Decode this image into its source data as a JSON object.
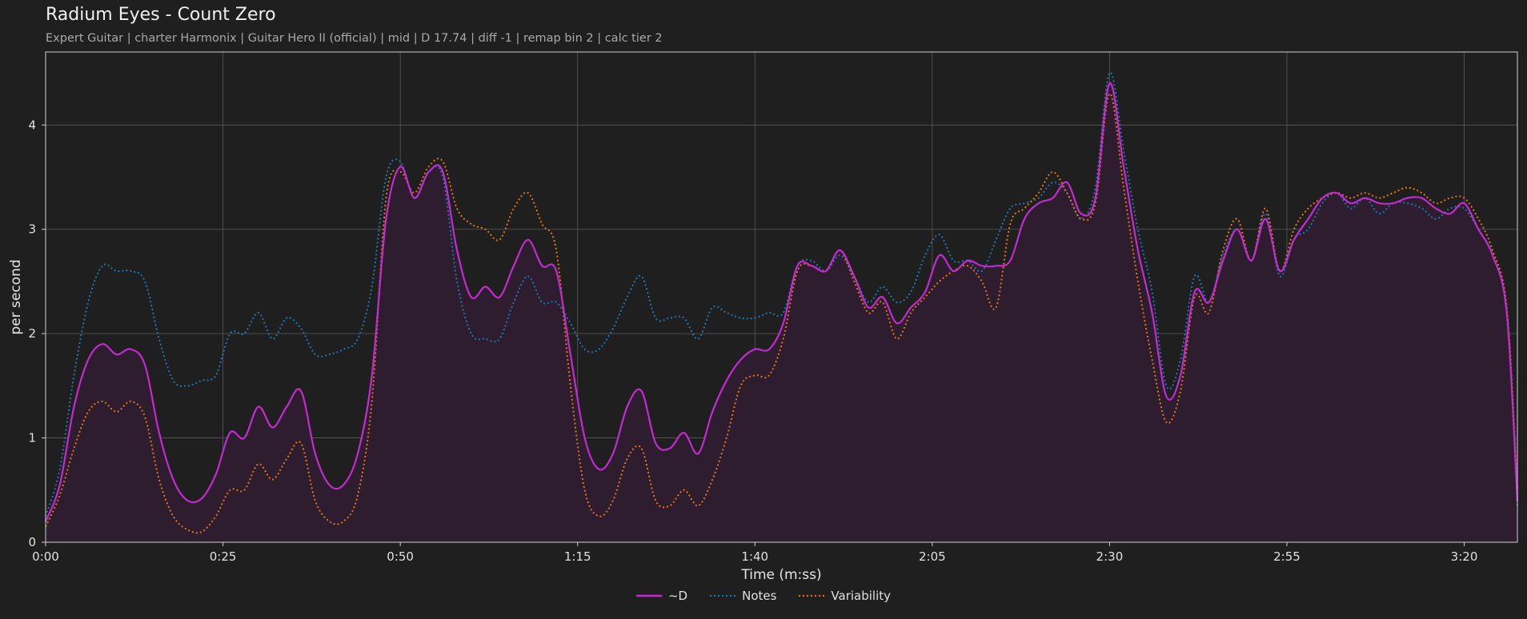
{
  "header": {
    "title": "Radium Eyes - Count Zero",
    "subtitle": "Expert Guitar  |  charter Harmonix  |  Guitar Hero II (official)  |  mid  |  D 17.74  |  diff -1  |  remap bin 2  |  calc tier 2"
  },
  "colors": {
    "background": "#1f1f1f",
    "d": "#c42ad0",
    "notes": "#1f77b4",
    "variability": "#e2761a",
    "fill": "#2e1c2f",
    "grid": "#5a5a5a"
  },
  "chart_data": {
    "type": "line",
    "xlabel": "Time (m:ss)",
    "ylabel": "per second",
    "xlim": [
      0,
      207.5
    ],
    "ylim": [
      0,
      4.7
    ],
    "x_ticks": [
      0,
      25,
      50,
      75,
      100,
      125,
      150,
      175,
      200
    ],
    "x_tick_labels": [
      "0:00",
      "0:25",
      "0:50",
      "1:15",
      "1:40",
      "2:05",
      "2:30",
      "2:55",
      "3:20"
    ],
    "y_ticks": [
      0,
      1,
      2,
      3,
      4
    ],
    "y_tick_labels": [
      "0",
      "1",
      "2",
      "3",
      "4"
    ],
    "grid": true,
    "legend_position": "bottom-center",
    "x": [
      0,
      2,
      4,
      6,
      8,
      10,
      12,
      14,
      16,
      18,
      20,
      22,
      24,
      26,
      28,
      30,
      32,
      34,
      36,
      38,
      40,
      42,
      44,
      46,
      48,
      50,
      52,
      54,
      56,
      58,
      60,
      62,
      64,
      66,
      68,
      70,
      72,
      74,
      76,
      78,
      80,
      82,
      84,
      86,
      88,
      90,
      92,
      94,
      96,
      98,
      100,
      102,
      104,
      106,
      108,
      110,
      112,
      114,
      116,
      118,
      120,
      122,
      124,
      126,
      128,
      130,
      132,
      134,
      136,
      138,
      140,
      142,
      144,
      146,
      148,
      150,
      152,
      154,
      156,
      158,
      160,
      162,
      164,
      166,
      168,
      170,
      172,
      174,
      176,
      178,
      180,
      182,
      184,
      186,
      188,
      190,
      192,
      194,
      196,
      198,
      200,
      202,
      204,
      206,
      207.5
    ],
    "series": [
      {
        "name": "~D",
        "style": "solid",
        "values": [
          0.2,
          0.55,
          1.3,
          1.75,
          1.9,
          1.8,
          1.85,
          1.7,
          1.05,
          0.6,
          0.4,
          0.42,
          0.65,
          1.05,
          1.0,
          1.3,
          1.1,
          1.3,
          1.45,
          0.85,
          0.55,
          0.55,
          0.85,
          1.6,
          3.1,
          3.6,
          3.3,
          3.55,
          3.55,
          2.8,
          2.35,
          2.45,
          2.35,
          2.65,
          2.9,
          2.65,
          2.6,
          1.8,
          1.0,
          0.7,
          0.85,
          1.3,
          1.45,
          0.95,
          0.9,
          1.05,
          0.85,
          1.25,
          1.55,
          1.75,
          1.85,
          1.85,
          2.1,
          2.65,
          2.65,
          2.6,
          2.8,
          2.55,
          2.25,
          2.35,
          2.1,
          2.25,
          2.4,
          2.75,
          2.6,
          2.7,
          2.65,
          2.65,
          2.7,
          3.1,
          3.25,
          3.3,
          3.45,
          3.15,
          3.3,
          4.4,
          3.6,
          2.8,
          2.2,
          1.4,
          1.6,
          2.4,
          2.3,
          2.7,
          3.0,
          2.7,
          3.1,
          2.6,
          2.9,
          3.1,
          3.3,
          3.35,
          3.25,
          3.3,
          3.25,
          3.25,
          3.3,
          3.3,
          3.2,
          3.15,
          3.25,
          3.0,
          2.75,
          2.2,
          0.4
        ]
      },
      {
        "name": "Notes",
        "style": "dotted",
        "values": [
          0.25,
          0.7,
          1.6,
          2.3,
          2.65,
          2.6,
          2.6,
          2.5,
          1.95,
          1.55,
          1.5,
          1.55,
          1.6,
          2.0,
          2.0,
          2.2,
          1.95,
          2.15,
          2.05,
          1.8,
          1.8,
          1.85,
          1.95,
          2.45,
          3.5,
          3.65,
          3.3,
          3.55,
          3.5,
          2.5,
          2.0,
          1.95,
          1.95,
          2.3,
          2.55,
          2.3,
          2.3,
          2.1,
          1.85,
          1.85,
          2.05,
          2.35,
          2.55,
          2.15,
          2.15,
          2.15,
          1.95,
          2.25,
          2.2,
          2.15,
          2.15,
          2.2,
          2.2,
          2.65,
          2.7,
          2.6,
          2.75,
          2.55,
          2.3,
          2.45,
          2.3,
          2.4,
          2.75,
          2.95,
          2.7,
          2.7,
          2.6,
          2.9,
          3.2,
          3.25,
          3.3,
          3.45,
          3.35,
          3.1,
          3.4,
          4.5,
          3.75,
          3.0,
          2.4,
          1.5,
          1.75,
          2.55,
          2.3,
          2.75,
          3.0,
          2.7,
          3.15,
          2.55,
          2.9,
          3.0,
          3.25,
          3.35,
          3.2,
          3.3,
          3.15,
          3.25,
          3.25,
          3.2,
          3.1,
          3.2,
          3.2,
          3.0,
          2.75,
          2.2,
          0.35
        ]
      },
      {
        "name": "Variability",
        "style": "dotted",
        "values": [
          0.15,
          0.45,
          0.9,
          1.25,
          1.35,
          1.25,
          1.35,
          1.2,
          0.6,
          0.25,
          0.12,
          0.1,
          0.25,
          0.5,
          0.5,
          0.75,
          0.6,
          0.8,
          0.95,
          0.4,
          0.2,
          0.2,
          0.45,
          1.35,
          3.3,
          3.55,
          3.35,
          3.6,
          3.65,
          3.2,
          3.05,
          3.0,
          2.9,
          3.2,
          3.35,
          3.05,
          2.8,
          1.5,
          0.5,
          0.25,
          0.4,
          0.8,
          0.9,
          0.4,
          0.35,
          0.5,
          0.35,
          0.6,
          1.0,
          1.5,
          1.6,
          1.6,
          1.95,
          2.6,
          2.65,
          2.6,
          2.8,
          2.5,
          2.2,
          2.3,
          1.95,
          2.2,
          2.35,
          2.5,
          2.6,
          2.65,
          2.5,
          2.25,
          3.05,
          3.2,
          3.35,
          3.55,
          3.35,
          3.1,
          3.25,
          4.3,
          3.4,
          2.5,
          1.75,
          1.15,
          1.45,
          2.35,
          2.2,
          2.8,
          3.1,
          2.7,
          3.2,
          2.6,
          3.0,
          3.2,
          3.3,
          3.35,
          3.3,
          3.35,
          3.3,
          3.35,
          3.4,
          3.35,
          3.25,
          3.3,
          3.3,
          3.1,
          2.8,
          2.25,
          0.5
        ]
      }
    ]
  }
}
